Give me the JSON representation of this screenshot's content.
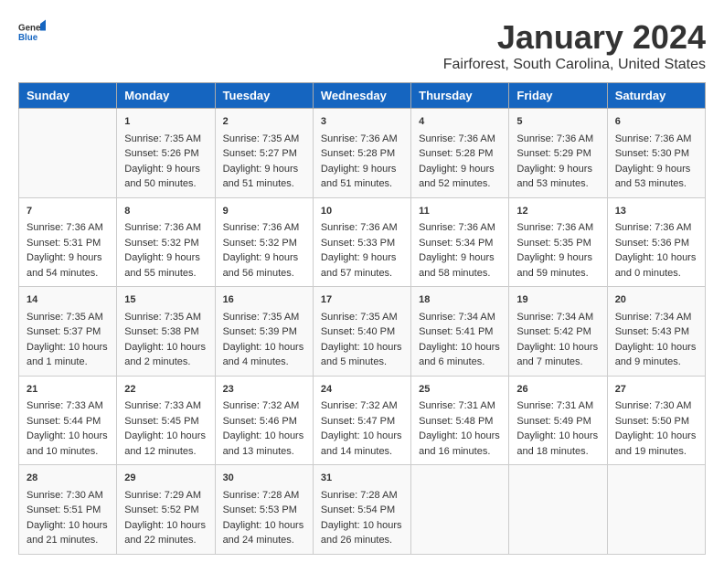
{
  "logo": {
    "text_general": "General",
    "text_blue": "Blue"
  },
  "title": "January 2024",
  "subtitle": "Fairforest, South Carolina, United States",
  "days_of_week": [
    "Sunday",
    "Monday",
    "Tuesday",
    "Wednesday",
    "Thursday",
    "Friday",
    "Saturday"
  ],
  "weeks": [
    [
      {
        "day": "",
        "content": ""
      },
      {
        "day": "1",
        "content": "Sunrise: 7:35 AM\nSunset: 5:26 PM\nDaylight: 9 hours\nand 50 minutes."
      },
      {
        "day": "2",
        "content": "Sunrise: 7:35 AM\nSunset: 5:27 PM\nDaylight: 9 hours\nand 51 minutes."
      },
      {
        "day": "3",
        "content": "Sunrise: 7:36 AM\nSunset: 5:28 PM\nDaylight: 9 hours\nand 51 minutes."
      },
      {
        "day": "4",
        "content": "Sunrise: 7:36 AM\nSunset: 5:28 PM\nDaylight: 9 hours\nand 52 minutes."
      },
      {
        "day": "5",
        "content": "Sunrise: 7:36 AM\nSunset: 5:29 PM\nDaylight: 9 hours\nand 53 minutes."
      },
      {
        "day": "6",
        "content": "Sunrise: 7:36 AM\nSunset: 5:30 PM\nDaylight: 9 hours\nand 53 minutes."
      }
    ],
    [
      {
        "day": "7",
        "content": "Sunrise: 7:36 AM\nSunset: 5:31 PM\nDaylight: 9 hours\nand 54 minutes."
      },
      {
        "day": "8",
        "content": "Sunrise: 7:36 AM\nSunset: 5:32 PM\nDaylight: 9 hours\nand 55 minutes."
      },
      {
        "day": "9",
        "content": "Sunrise: 7:36 AM\nSunset: 5:32 PM\nDaylight: 9 hours\nand 56 minutes."
      },
      {
        "day": "10",
        "content": "Sunrise: 7:36 AM\nSunset: 5:33 PM\nDaylight: 9 hours\nand 57 minutes."
      },
      {
        "day": "11",
        "content": "Sunrise: 7:36 AM\nSunset: 5:34 PM\nDaylight: 9 hours\nand 58 minutes."
      },
      {
        "day": "12",
        "content": "Sunrise: 7:36 AM\nSunset: 5:35 PM\nDaylight: 9 hours\nand 59 minutes."
      },
      {
        "day": "13",
        "content": "Sunrise: 7:36 AM\nSunset: 5:36 PM\nDaylight: 10 hours\nand 0 minutes."
      }
    ],
    [
      {
        "day": "14",
        "content": "Sunrise: 7:35 AM\nSunset: 5:37 PM\nDaylight: 10 hours\nand 1 minute."
      },
      {
        "day": "15",
        "content": "Sunrise: 7:35 AM\nSunset: 5:38 PM\nDaylight: 10 hours\nand 2 minutes."
      },
      {
        "day": "16",
        "content": "Sunrise: 7:35 AM\nSunset: 5:39 PM\nDaylight: 10 hours\nand 4 minutes."
      },
      {
        "day": "17",
        "content": "Sunrise: 7:35 AM\nSunset: 5:40 PM\nDaylight: 10 hours\nand 5 minutes."
      },
      {
        "day": "18",
        "content": "Sunrise: 7:34 AM\nSunset: 5:41 PM\nDaylight: 10 hours\nand 6 minutes."
      },
      {
        "day": "19",
        "content": "Sunrise: 7:34 AM\nSunset: 5:42 PM\nDaylight: 10 hours\nand 7 minutes."
      },
      {
        "day": "20",
        "content": "Sunrise: 7:34 AM\nSunset: 5:43 PM\nDaylight: 10 hours\nand 9 minutes."
      }
    ],
    [
      {
        "day": "21",
        "content": "Sunrise: 7:33 AM\nSunset: 5:44 PM\nDaylight: 10 hours\nand 10 minutes."
      },
      {
        "day": "22",
        "content": "Sunrise: 7:33 AM\nSunset: 5:45 PM\nDaylight: 10 hours\nand 12 minutes."
      },
      {
        "day": "23",
        "content": "Sunrise: 7:32 AM\nSunset: 5:46 PM\nDaylight: 10 hours\nand 13 minutes."
      },
      {
        "day": "24",
        "content": "Sunrise: 7:32 AM\nSunset: 5:47 PM\nDaylight: 10 hours\nand 14 minutes."
      },
      {
        "day": "25",
        "content": "Sunrise: 7:31 AM\nSunset: 5:48 PM\nDaylight: 10 hours\nand 16 minutes."
      },
      {
        "day": "26",
        "content": "Sunrise: 7:31 AM\nSunset: 5:49 PM\nDaylight: 10 hours\nand 18 minutes."
      },
      {
        "day": "27",
        "content": "Sunrise: 7:30 AM\nSunset: 5:50 PM\nDaylight: 10 hours\nand 19 minutes."
      }
    ],
    [
      {
        "day": "28",
        "content": "Sunrise: 7:30 AM\nSunset: 5:51 PM\nDaylight: 10 hours\nand 21 minutes."
      },
      {
        "day": "29",
        "content": "Sunrise: 7:29 AM\nSunset: 5:52 PM\nDaylight: 10 hours\nand 22 minutes."
      },
      {
        "day": "30",
        "content": "Sunrise: 7:28 AM\nSunset: 5:53 PM\nDaylight: 10 hours\nand 24 minutes."
      },
      {
        "day": "31",
        "content": "Sunrise: 7:28 AM\nSunset: 5:54 PM\nDaylight: 10 hours\nand 26 minutes."
      },
      {
        "day": "",
        "content": ""
      },
      {
        "day": "",
        "content": ""
      },
      {
        "day": "",
        "content": ""
      }
    ]
  ]
}
